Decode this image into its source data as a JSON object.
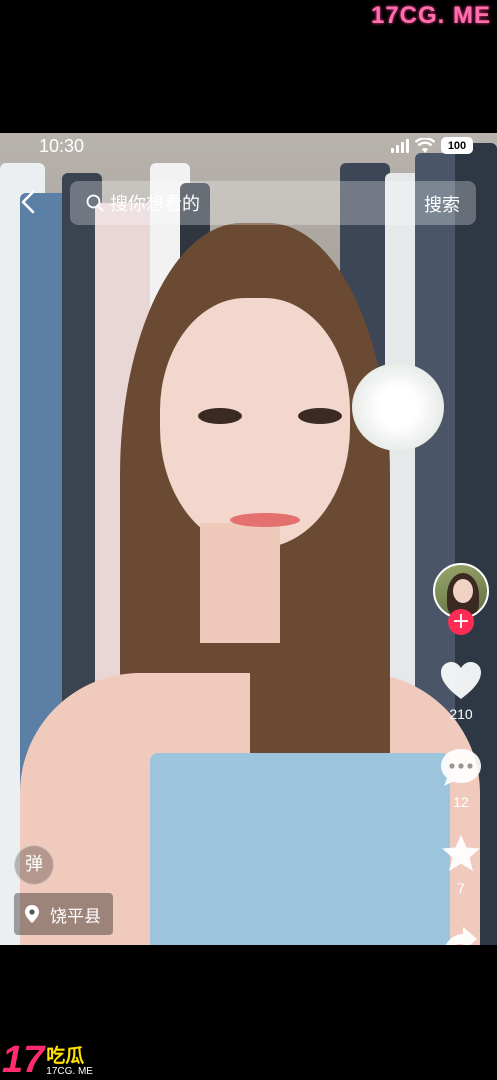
{
  "watermark": {
    "top_text": "17CG. ME",
    "bottom_number": "17",
    "bottom_cn": "吃瓜",
    "bottom_domain": "17CG. ME"
  },
  "status_bar": {
    "time": "10:30",
    "battery": "100"
  },
  "search": {
    "placeholder": "搜你想看的",
    "button_label": "搜索"
  },
  "actions": {
    "like_count": "210",
    "comment_count": "12",
    "favorite_count": "7"
  },
  "danmu_label": "弹",
  "location_label": "饶平县",
  "colors": {
    "accent": "#fe2c55",
    "watermark_pink": "#ff6fae",
    "watermark_yellow": "#ffe100"
  },
  "icons": [
    "back-icon",
    "search-icon",
    "heart-icon",
    "comment-icon",
    "star-icon",
    "share-icon",
    "location-pin-icon",
    "signal-icon",
    "wifi-icon",
    "battery-icon"
  ]
}
